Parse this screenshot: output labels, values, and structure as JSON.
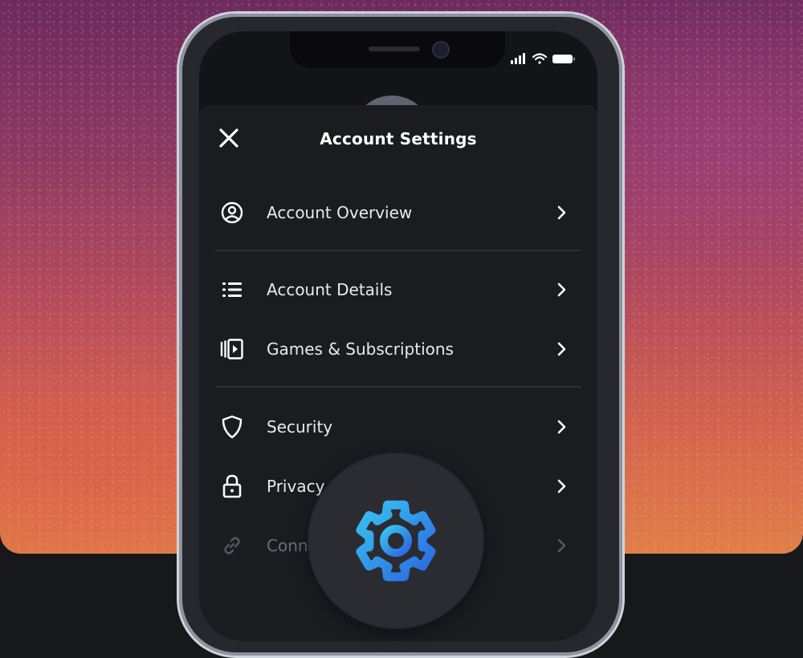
{
  "header": {
    "title": "Account Settings"
  },
  "menu": {
    "items": [
      {
        "label": "Account Overview",
        "icon": "user-circle-icon"
      },
      {
        "label": "Account Details",
        "icon": "list-icon"
      },
      {
        "label": "Games & Subscriptions",
        "icon": "media-library-icon"
      },
      {
        "label": "Security",
        "icon": "shield-icon"
      },
      {
        "label": "Privacy",
        "icon": "lock-icon"
      },
      {
        "label": "Conn",
        "icon": "link-icon"
      }
    ]
  },
  "theme": {
    "accent_gradient_start": "#39c3f0",
    "accent_gradient_end": "#2a66e0",
    "panel_bg": "#1b1c20",
    "text_color": "#e9eaee"
  },
  "badge": {
    "icon": "gear-icon"
  }
}
